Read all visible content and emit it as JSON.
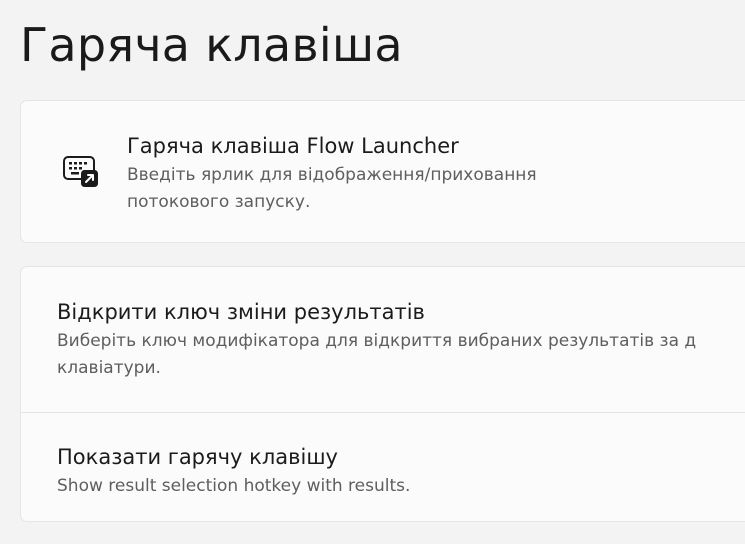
{
  "page": {
    "title": "Гаряча клавіша"
  },
  "hotkey_card": {
    "icon": "keyboard-shortcut-icon",
    "title": "Гаряча клавіша Flow Launcher",
    "desc_line1": "Введіть ярлик для відображення/приховання",
    "desc_line2": "потокового запуску."
  },
  "settings": [
    {
      "title": "Відкрити ключ зміни результатів",
      "desc_line1": "Виберіть ключ модифікатора для відкриття вибраних результатів за д",
      "desc_line2": "клавіатури."
    },
    {
      "title": "Показати гарячу клавішу",
      "desc_line1": "Show result selection hotkey with results."
    }
  ]
}
